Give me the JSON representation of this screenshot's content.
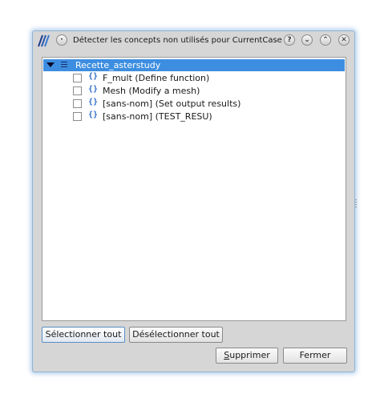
{
  "window": {
    "title": "Détecter les concepts non utilisés pour CurrentCase"
  },
  "titlebar_buttons": {
    "menu": "·",
    "help": "?",
    "minimize": "⌄",
    "maximize": "⌃",
    "close": "✕"
  },
  "tree": {
    "root": {
      "label": "Recette_asterstudy",
      "expanded": true,
      "selected": true
    },
    "items": [
      {
        "label": "F_mult (Define function)",
        "checked": false
      },
      {
        "label": "Mesh (Modify a mesh)",
        "checked": false
      },
      {
        "label": "[sans-nom] (Set output results)",
        "checked": false
      },
      {
        "label": "[sans-nom] (TEST_RESU)",
        "checked": false
      }
    ]
  },
  "buttons": {
    "select_all": "Sélectionner tout",
    "deselect_all": "Désélectionner tout",
    "delete_first": "S",
    "delete_rest": "upprimer",
    "close": "Fermer"
  },
  "colors": {
    "selection": "#3d8ee0",
    "window_bg": "#d6d6d6",
    "glow": "#8fb4d6",
    "icon_blue": "#2f6fc4"
  },
  "icons": {
    "app": "asterstudy-logo-icon",
    "root": "list-icon",
    "item": "braces-icon"
  }
}
